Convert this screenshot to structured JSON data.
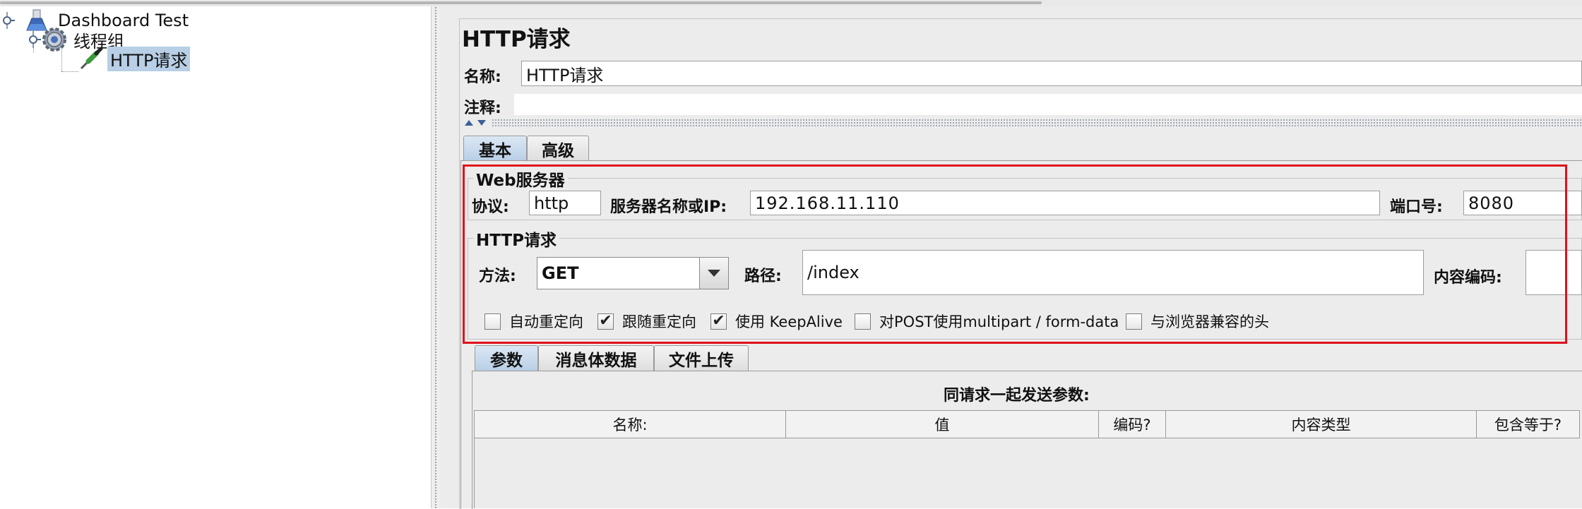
{
  "tree": {
    "items": [
      {
        "label": "Dashboard Test",
        "icon": "flask-icon"
      },
      {
        "label": "线程组",
        "icon": "gear-icon"
      },
      {
        "label": "HTTP请求",
        "icon": "pipette-icon",
        "selected": true
      }
    ]
  },
  "panel": {
    "title": "HTTP请求",
    "name_label": "名称:",
    "name_value": "HTTP请求",
    "comment_label": "注释:",
    "comment_value": ""
  },
  "tabs": [
    {
      "label": "基本",
      "active": true
    },
    {
      "label": "高级",
      "active": false
    }
  ],
  "web_server": {
    "title": "Web服务器",
    "protocol_label": "协议:",
    "protocol_value": "http",
    "server_label": "服务器名称或IP:",
    "server_value": "192.168.11.110",
    "port_label": "端口号:",
    "port_value": "8080"
  },
  "http_request": {
    "title": "HTTP请求",
    "method_label": "方法:",
    "method_value": "GET",
    "path_label": "路径:",
    "path_value": "/index",
    "encoding_label": "内容编码:",
    "encoding_value": ""
  },
  "options": [
    {
      "label": "自动重定向",
      "checked": false
    },
    {
      "label": "跟随重定向",
      "checked": true
    },
    {
      "label": "使用 KeepAlive",
      "checked": true
    },
    {
      "label": "对POST使用multipart / form-data",
      "checked": false
    },
    {
      "label": "与浏览器兼容的头",
      "checked": false
    }
  ],
  "sub_tabs": [
    {
      "label": "参数",
      "active": true
    },
    {
      "label": "消息体数据",
      "active": false
    },
    {
      "label": "文件上传",
      "active": false
    }
  ],
  "params": {
    "caption": "同请求一起发送参数:",
    "columns": [
      "名称:",
      "值",
      "编码?",
      "内容类型",
      "包含等于?"
    ]
  },
  "colors": {
    "highlight": "#e0101a",
    "selection": "#b8cfe5",
    "panel_bg": "#ececec"
  },
  "check_mark": "✔"
}
